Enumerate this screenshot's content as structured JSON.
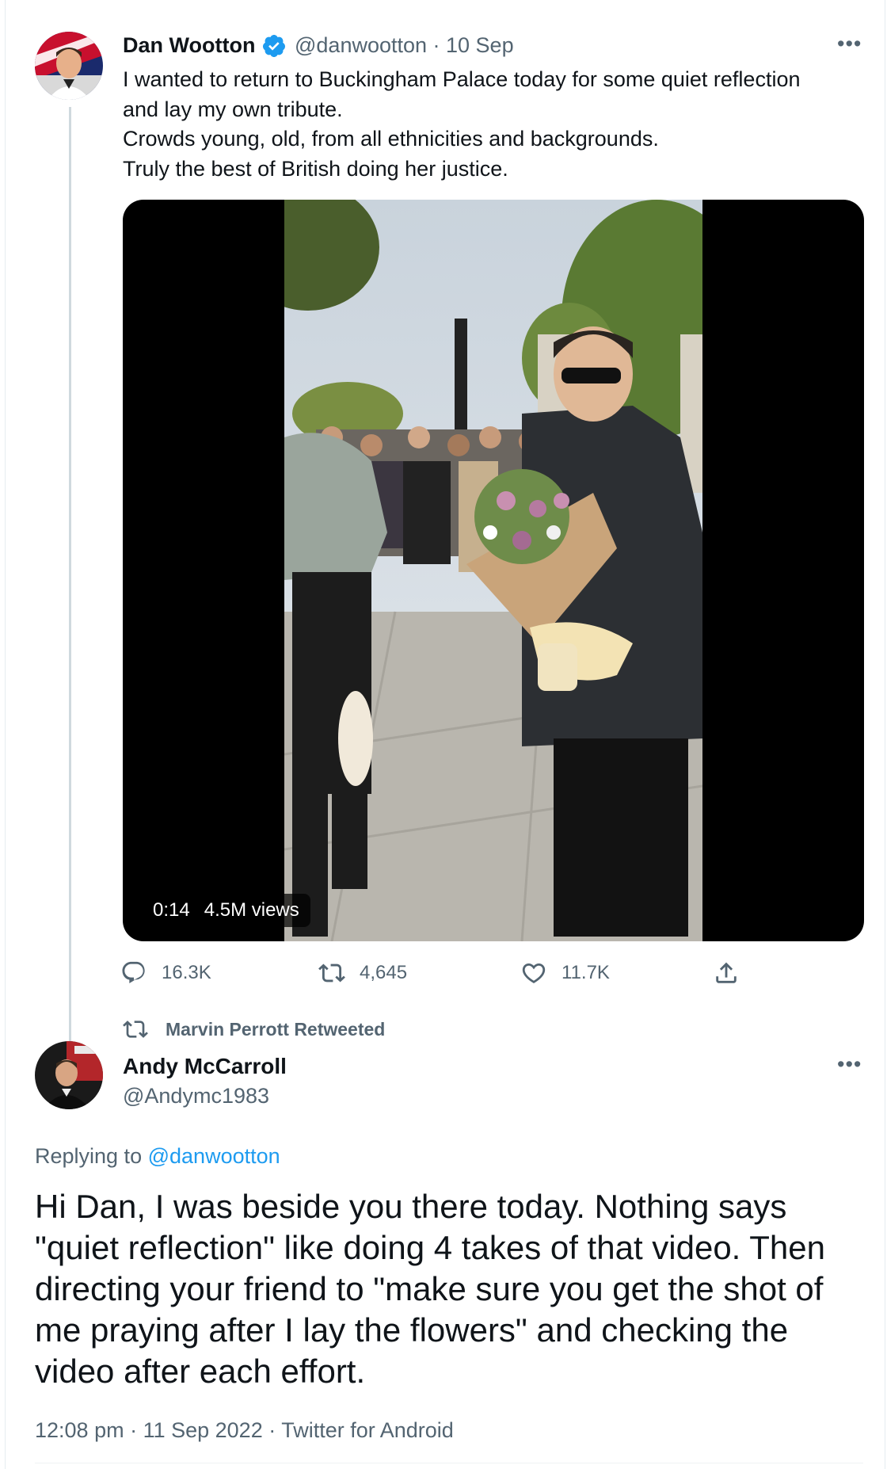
{
  "parent_tweet": {
    "author_name": "Dan Wootton",
    "handle_date": "@danwootton · 10 Sep",
    "text_lines": [
      "I wanted to return to Buckingham Palace today for some quiet reflection",
      "and lay my own tribute.",
      "Crowds young, old, from all ethnicities and backgrounds.",
      "Truly the best of British doing her justice."
    ],
    "video": {
      "duration": "0:14",
      "views": "4.5M views"
    },
    "actions": {
      "replies": "16.3K",
      "retweets": "4,645",
      "likes": "11.7K"
    },
    "more_label": "•••"
  },
  "retweet_context": "Marvin Perrott Retweeted",
  "reply_tweet": {
    "author_name": "Andy McCarroll",
    "handle": "@Andymc1983",
    "replying_prefix": "Replying to",
    "replying_handle": "@danwootton",
    "text_lines": [
      "Hi Dan, I was beside you there today. Nothing says",
      "\"quiet reflection\" like doing 4 takes of that video. Then",
      "directing your friend to \"make sure you get the shot of",
      "me praying after I lay the flowers\" and checking the",
      "video after each effort."
    ],
    "meta": "12:08 pm · 11 Sep 2022 · Twitter for Android",
    "more_label": "•••"
  },
  "colors": {
    "accent": "#1d9bf0",
    "secondary_text": "#536471",
    "primary_text": "#0f1419",
    "thread_line": "#cfd9de"
  },
  "icons": [
    "verified-badge-icon",
    "reply-icon",
    "retweet-icon",
    "like-icon",
    "share-icon",
    "more-icon"
  ]
}
